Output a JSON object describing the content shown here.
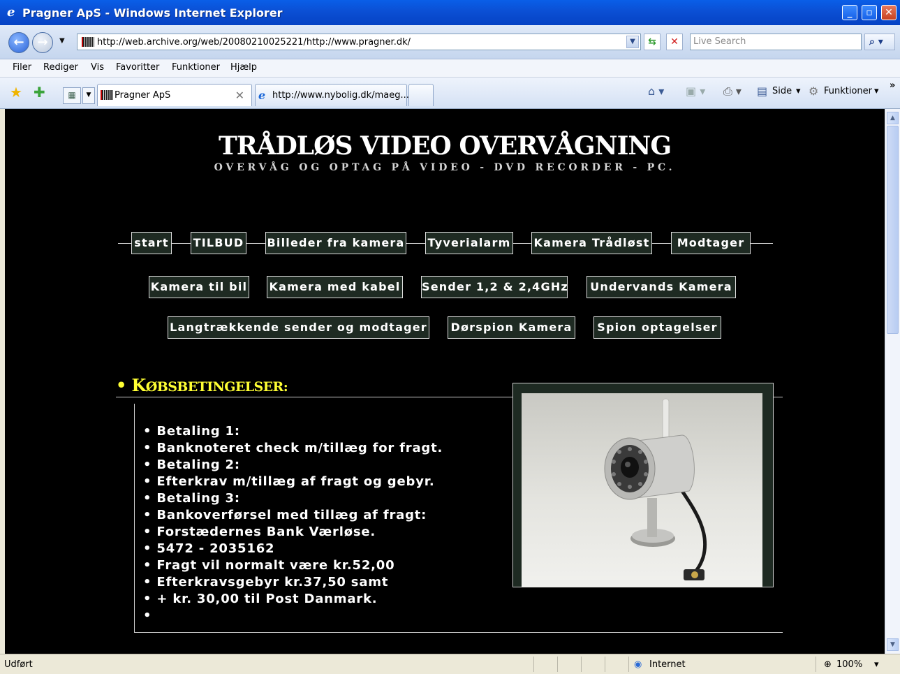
{
  "window": {
    "title": "Pragner ApS - Windows Internet Explorer",
    "minimize_glyph": "_",
    "maximize_glyph": "▫",
    "close_glyph": "✕"
  },
  "address_bar": {
    "url": "http://web.archive.org/web/20080210025221/http://www.pragner.dk/",
    "search_placeholder": "Live Search"
  },
  "menu": [
    "Filer",
    "Rediger",
    "Vis",
    "Favoritter",
    "Funktioner",
    "Hjælp"
  ],
  "tabs": [
    {
      "label": "Pragner ApS",
      "active": true
    },
    {
      "label": "http://www.nybolig.dk/maeg...",
      "active": false
    }
  ],
  "commands": {
    "page": "Side",
    "tools": "Funktioner"
  },
  "site": {
    "title": "TRÅDLØS VIDEO  OVERVÅGNING",
    "subtitle": "OVERVÅG OG OPTAG PÅ VIDEO - DVD RECORDER - PC.",
    "nav_row1": [
      "start",
      "TILBUD",
      "Billeder fra kamera",
      "Tyverialarm",
      "Kamera Trådløst",
      "Modtager"
    ],
    "nav_row2": [
      "Kamera til bil",
      "Kamera med kabel",
      "Sender 1,2 & 2,4GHz",
      "Undervands Kamera"
    ],
    "nav_row3": [
      "Langtrækkende sender og modtager",
      "Dørspion Kamera",
      "Spion optagelser"
    ],
    "section": {
      "bullet": "•",
      "first_letter": "K",
      "rest": "ØBSBETINGELSER:"
    },
    "terms": [
      "• Betaling 1:",
      "• Banknoteret check m/tillæg for fragt.",
      "• Betaling 2:",
      "• Efterkrav m/tillæg af fragt og gebyr.",
      "• Betaling 3:",
      "• Bankoverførsel med tillæg af fragt:",
      "• Forstædernes Bank Værløse.",
      "• 5472 - 2035162",
      "• Fragt vil normalt være kr.52,00",
      "• Efterkravsgebyr kr.37,50 samt",
      "• + kr. 30,00 til Post Danmark.",
      "•"
    ]
  },
  "status": {
    "left": "Udført",
    "zone": "Internet",
    "zoom": "100%"
  },
  "colors": {
    "page_bg": "#000000",
    "heading_yellow": "#ffff33",
    "button_bg": "#1e2a22"
  }
}
